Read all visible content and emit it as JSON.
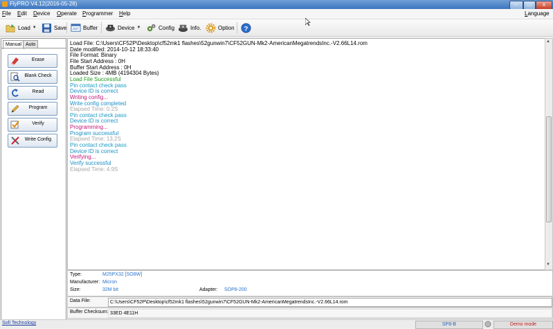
{
  "window": {
    "title": "FlyPRO V4.12(2016-05-28)",
    "btn_min": "–",
    "btn_max": "□",
    "btn_close": "x"
  },
  "menu": {
    "items": [
      "File",
      "Edit",
      "Device",
      "Operate",
      "Programmer",
      "Help"
    ],
    "language": "Language"
  },
  "toolbar": {
    "load": "Load",
    "save": "Save",
    "buffer": "Buffer",
    "device": "Device",
    "config": "Config",
    "info": "Info.",
    "option": "Option",
    "help_glyph": "?"
  },
  "tabs": {
    "manual": "Manual",
    "auto": "Auto"
  },
  "ops": {
    "erase": "Erase",
    "blank_check": "Blank Check",
    "read": "Read",
    "program": "Program",
    "verify": "Verify",
    "write_config": "Write Config"
  },
  "log": [
    {
      "text": "Load File: C:\\Users\\CF52P\\Desktop\\cf52mk1 flashes\\52gunwin7\\CF52GUN-Mk2-AmericanMegatrendsInc.-V2.66L14.rom",
      "color": "#000000"
    },
    {
      "text": "Date modified: 2014-10-12 18:33:40",
      "color": "#000000"
    },
    {
      "text": "File Format: Binary",
      "color": "#000000"
    },
    {
      "text": "File Start Address      : 0H",
      "color": "#000000"
    },
    {
      "text": "Buffer Start Address  : 0H",
      "color": "#000000"
    },
    {
      "text": "Loaded Size  : 4MB (4194304 Bytes)",
      "color": "#000000"
    },
    {
      "text": "Load File Successful",
      "color": "#1f9a1f"
    },
    {
      "text": "Pin contact check pass",
      "color": "#1a9bc2"
    },
    {
      "text": "Device ID is correct",
      "color": "#1a8fc4"
    },
    {
      "text": "Writing config...",
      "color": "#c0187a"
    },
    {
      "text": "Write config completed",
      "color": "#1a8fc4"
    },
    {
      "text": "Elapsed Time: 0.2S",
      "color": "#a8a8a8"
    },
    {
      "text": "Pin contact check pass",
      "color": "#1a9bc2"
    },
    {
      "text": "Device ID is correct",
      "color": "#1a8fc4"
    },
    {
      "text": "Programming...",
      "color": "#c0187a"
    },
    {
      "text": "Program successful",
      "color": "#1a8fc4"
    },
    {
      "text": "Elapsed Time: 13.2S",
      "color": "#a8a8a8"
    },
    {
      "text": "Pin contact check pass",
      "color": "#1a9bc2"
    },
    {
      "text": "Device ID is correct",
      "color": "#1a8fc4"
    },
    {
      "text": "Verifying...",
      "color": "#c0187a"
    },
    {
      "text": "Verify successful",
      "color": "#1a8fc4"
    },
    {
      "text": "Elapsed Time: 4.9S",
      "color": "#a8a8a8"
    }
  ],
  "scroll": {
    "up": "▲",
    "down": "▼"
  },
  "info": {
    "type_label": "Type:",
    "type_value": "M25PX32 [SO8W]",
    "manufacturer_label": "Manufacturer:",
    "manufacturer_value": "Micron",
    "size_label": "Size:",
    "size_value": "32M bit",
    "adapter_label": "Adapter:",
    "adapter_value": "SOP8-200"
  },
  "datafile": {
    "label": "Data File:",
    "value": "C:\\Users\\CF52P\\Desktop\\cf52mk1 flashes\\52gunwin7\\CF52GUN-Mk2-AmericanMegatrendsInc.-V2.66L14.rom"
  },
  "checksum": {
    "label": "Buffer Checksum:",
    "value": "33ED 4E11H"
  },
  "status": {
    "company": "Sofi Technology",
    "programmer": "SP8-B",
    "mode": "Demo mode"
  }
}
